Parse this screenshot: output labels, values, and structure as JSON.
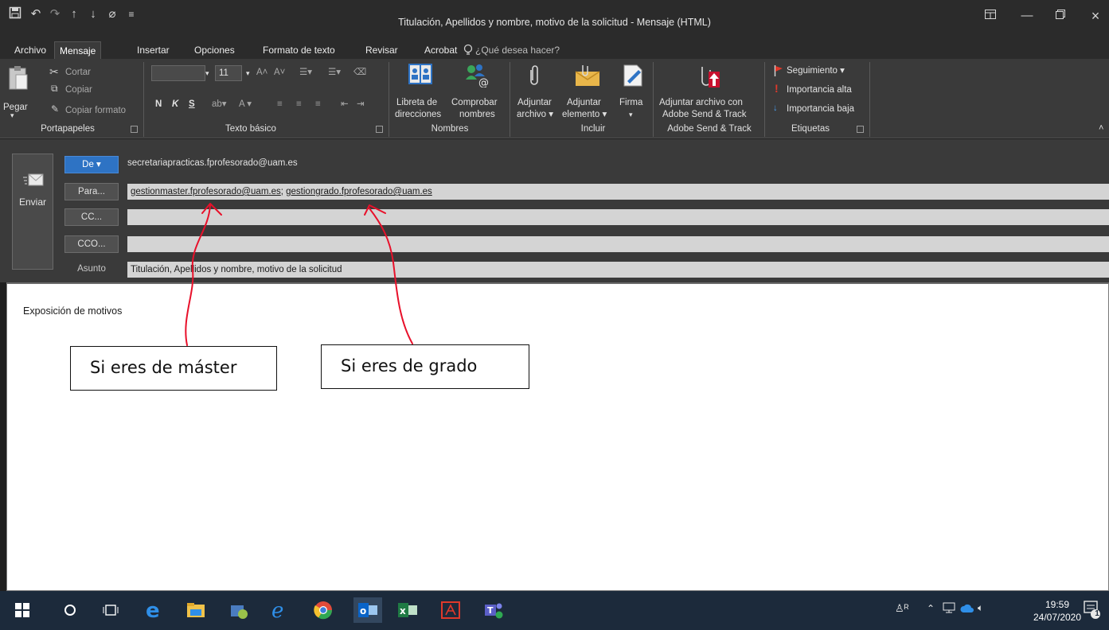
{
  "window": {
    "title": "Titulación, Apellidos y nombre, motivo de la solicitud - Mensaje (HTML)"
  },
  "tabs": {
    "archivo": "Archivo",
    "mensaje": "Mensaje",
    "insertar": "Insertar",
    "opciones": "Opciones",
    "formato": "Formato de texto",
    "revisar": "Revisar",
    "acrobat": "Acrobat",
    "tellme": "¿Qué desea hacer?"
  },
  "ribbon": {
    "portapapeles": {
      "label": "Portapapeles",
      "pegar": "Pegar",
      "cortar": "Cortar",
      "copiar": "Copiar",
      "copiar_formato": "Copiar formato"
    },
    "texto_basico": {
      "label": "Texto básico",
      "font_size": "11",
      "bold": "N",
      "italic": "K",
      "underline": "S"
    },
    "nombres": {
      "label": "Nombres",
      "libreta_1": "Libreta de",
      "libreta_2": "direcciones",
      "comprobar_1": "Comprobar",
      "comprobar_2": "nombres"
    },
    "incluir": {
      "label": "Incluir",
      "adj_archivo_1": "Adjuntar",
      "adj_archivo_2": "archivo ▾",
      "adj_elemento_1": "Adjuntar",
      "adj_elemento_2": "elemento ▾",
      "firma": "Firma",
      "firma_arrow": "▾"
    },
    "adobe": {
      "label": "Adobe Send & Track",
      "btn_1": "Adjuntar archivo con",
      "btn_2": "Adobe Send & Track"
    },
    "etiquetas": {
      "label": "Etiquetas",
      "seguimiento": "Seguimiento ▾",
      "alta": "Importancia alta",
      "baja": "Importancia baja"
    }
  },
  "compose": {
    "send_label": "Enviar",
    "from_button": "De ▾",
    "from_value": "secretariapracticas.fprofesorado@uam.es",
    "to_button": "Para...",
    "to_address_1": "gestionmaster.fprofesorado@uam.es",
    "to_separator": "; ",
    "to_address_2": "gestiongrado.fprofesorado@uam.es",
    "cc_button": "CC...",
    "cc_value": "",
    "bcc_button": "CCO...",
    "bcc_value": "",
    "subject_label": "Asunto",
    "subject_value": "Titulación, Apellidos y nombre, motivo de la solicitud"
  },
  "body": {
    "text": "Exposición de motivos"
  },
  "annotations": {
    "master": "Si eres de máster",
    "grado": "Si eres de grado",
    "arrow_color": "#e8102a"
  },
  "taskbar": {
    "time": "19:59",
    "date": "24/07/2020",
    "notification_count": "1"
  },
  "colors": {
    "ribbon_bg": "#3a3a3a",
    "title_bg": "#2b2b2b",
    "accent": "#2e73c4",
    "taskbar_bg": "#1c2a3b"
  }
}
